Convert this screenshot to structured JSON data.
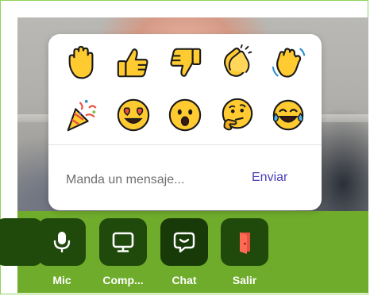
{
  "popup": {
    "reactions": [
      {
        "name": "raised-hand"
      },
      {
        "name": "thumbs-up"
      },
      {
        "name": "thumbs-down"
      },
      {
        "name": "clapping-hands"
      },
      {
        "name": "waving-hand"
      },
      {
        "name": "party-popper"
      },
      {
        "name": "heart-eyes-face"
      },
      {
        "name": "surprised-face"
      },
      {
        "name": "thinking-face"
      },
      {
        "name": "tears-of-joy-face"
      }
    ],
    "message_placeholder": "Manda un mensaje...",
    "send_label": "Enviar"
  },
  "toolbar": {
    "items": [
      {
        "label": "",
        "icon": "more-icon"
      },
      {
        "label": "Mic",
        "icon": "microphone-icon"
      },
      {
        "label": "Comp...",
        "icon": "monitor-icon"
      },
      {
        "label": "Chat",
        "icon": "chat-icon"
      },
      {
        "label": "Salir",
        "icon": "exit-door-icon"
      }
    ]
  },
  "colors": {
    "toolbar_bg": "#6fac2b",
    "tile_bg": "#1f4a0c",
    "accent": "#4a3fb8",
    "exit": "#e8503f",
    "emoji_yellow": "#ffcb30"
  }
}
